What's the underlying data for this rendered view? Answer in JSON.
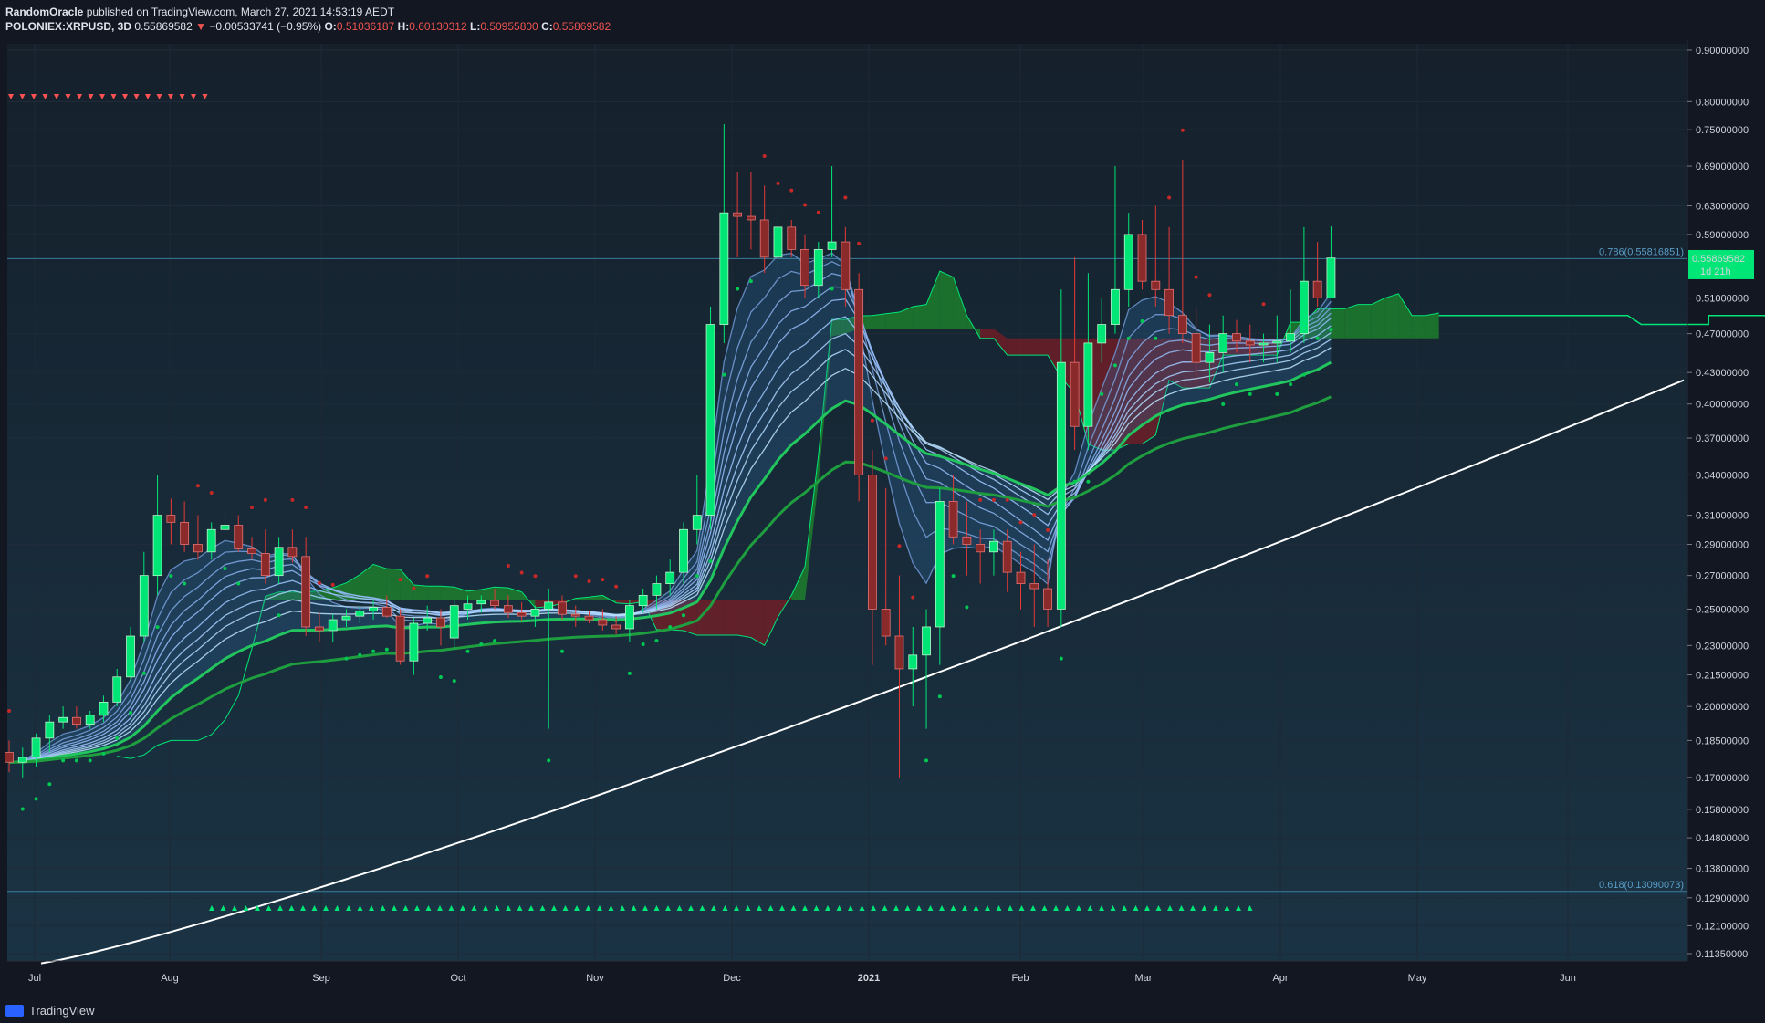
{
  "header": {
    "author": "RandomOracle",
    "published_text": " published on TradingView.com, March 27, 2021 14:53:19 AEDT",
    "symbol": "POLONIEX:XRPUSD, 3D",
    "last": "0.55869582",
    "change_arrow": "▼",
    "change": "−0.00533741 (−0.95%)",
    "o_label": "O:",
    "o": "0.51036187",
    "h_label": "H:",
    "h": "0.60130312",
    "l_label": "L:",
    "l": "0.50955800",
    "c_label": "C:",
    "c": "0.55869582"
  },
  "footer": {
    "brand": "TradingView"
  },
  "colors": {
    "background": "#131722",
    "bull": "#00e676",
    "bear": "#c0392b",
    "cloud_green": "#1f8a2c",
    "cloud_red": "#7a1e26"
  },
  "chart_data": {
    "type": "candlestick",
    "y_scale": "log",
    "ylim": [
      0.11,
      0.92
    ],
    "y_ticks": [
      "0.90000000",
      "0.80000000",
      "0.75000000",
      "0.69000000",
      "0.63000000",
      "0.59000000",
      "0.55869582",
      "0.51000000",
      "0.47000000",
      "0.43000000",
      "0.40000000",
      "0.37000000",
      "0.34000000",
      "0.31000000",
      "0.29000000",
      "0.27000000",
      "0.25000000",
      "0.23000000",
      "0.21500000",
      "0.20000000",
      "0.18500000",
      "0.17000000",
      "0.15800000",
      "0.14800000",
      "0.13800000",
      "0.12900000",
      "0.12100000",
      "0.11350000"
    ],
    "x_labels": [
      "Jul",
      "Aug",
      "Sep",
      "Oct",
      "Nov",
      "Dec",
      "2021",
      "Feb",
      "Mar",
      "Apr",
      "May",
      "Jun"
    ],
    "price_label": "0.55869582",
    "countdown": "1d 21h",
    "fib_lines": [
      {
        "label": "0.786(0.55816851)",
        "value": 0.55816851
      },
      {
        "label": "0.618(0.13090073)",
        "value": 0.13090073
      }
    ],
    "candles": [
      {
        "o": 0.18,
        "h": 0.185,
        "l": 0.172,
        "c": 0.176
      },
      {
        "o": 0.176,
        "h": 0.182,
        "l": 0.17,
        "c": 0.178
      },
      {
        "o": 0.178,
        "h": 0.188,
        "l": 0.174,
        "c": 0.186
      },
      {
        "o": 0.186,
        "h": 0.196,
        "l": 0.18,
        "c": 0.193
      },
      {
        "o": 0.193,
        "h": 0.2,
        "l": 0.19,
        "c": 0.195
      },
      {
        "o": 0.195,
        "h": 0.2,
        "l": 0.19,
        "c": 0.192
      },
      {
        "o": 0.192,
        "h": 0.198,
        "l": 0.19,
        "c": 0.196
      },
      {
        "o": 0.196,
        "h": 0.205,
        "l": 0.193,
        "c": 0.202
      },
      {
        "o": 0.202,
        "h": 0.218,
        "l": 0.2,
        "c": 0.214
      },
      {
        "o": 0.214,
        "h": 0.24,
        "l": 0.212,
        "c": 0.235
      },
      {
        "o": 0.235,
        "h": 0.285,
        "l": 0.232,
        "c": 0.27
      },
      {
        "o": 0.27,
        "h": 0.34,
        "l": 0.258,
        "c": 0.31
      },
      {
        "o": 0.31,
        "h": 0.322,
        "l": 0.29,
        "c": 0.305
      },
      {
        "o": 0.305,
        "h": 0.32,
        "l": 0.285,
        "c": 0.29
      },
      {
        "o": 0.29,
        "h": 0.31,
        "l": 0.28,
        "c": 0.285
      },
      {
        "o": 0.285,
        "h": 0.305,
        "l": 0.28,
        "c": 0.3
      },
      {
        "o": 0.3,
        "h": 0.312,
        "l": 0.295,
        "c": 0.303
      },
      {
        "o": 0.303,
        "h": 0.31,
        "l": 0.285,
        "c": 0.287
      },
      {
        "o": 0.287,
        "h": 0.295,
        "l": 0.28,
        "c": 0.284
      },
      {
        "o": 0.284,
        "h": 0.3,
        "l": 0.265,
        "c": 0.27
      },
      {
        "o": 0.27,
        "h": 0.295,
        "l": 0.265,
        "c": 0.288
      },
      {
        "o": 0.288,
        "h": 0.3,
        "l": 0.278,
        "c": 0.282
      },
      {
        "o": 0.282,
        "h": 0.295,
        "l": 0.235,
        "c": 0.24
      },
      {
        "o": 0.24,
        "h": 0.248,
        "l": 0.232,
        "c": 0.238
      },
      {
        "o": 0.238,
        "h": 0.247,
        "l": 0.232,
        "c": 0.244
      },
      {
        "o": 0.244,
        "h": 0.25,
        "l": 0.24,
        "c": 0.246
      },
      {
        "o": 0.246,
        "h": 0.252,
        "l": 0.242,
        "c": 0.249
      },
      {
        "o": 0.249,
        "h": 0.255,
        "l": 0.244,
        "c": 0.251
      },
      {
        "o": 0.251,
        "h": 0.258,
        "l": 0.245,
        "c": 0.246
      },
      {
        "o": 0.246,
        "h": 0.25,
        "l": 0.22,
        "c": 0.222
      },
      {
        "o": 0.222,
        "h": 0.245,
        "l": 0.215,
        "c": 0.242
      },
      {
        "o": 0.242,
        "h": 0.252,
        "l": 0.238,
        "c": 0.245
      },
      {
        "o": 0.245,
        "h": 0.25,
        "l": 0.23,
        "c": 0.24
      },
      {
        "o": 0.234,
        "h": 0.255,
        "l": 0.228,
        "c": 0.252
      },
      {
        "o": 0.25,
        "h": 0.258,
        "l": 0.244,
        "c": 0.253
      },
      {
        "o": 0.253,
        "h": 0.258,
        "l": 0.248,
        "c": 0.255
      },
      {
        "o": 0.255,
        "h": 0.262,
        "l": 0.25,
        "c": 0.252
      },
      {
        "o": 0.252,
        "h": 0.258,
        "l": 0.245,
        "c": 0.248
      },
      {
        "o": 0.248,
        "h": 0.254,
        "l": 0.243,
        "c": 0.246
      },
      {
        "o": 0.246,
        "h": 0.252,
        "l": 0.24,
        "c": 0.25
      },
      {
        "o": 0.25,
        "h": 0.262,
        "l": 0.19,
        "c": 0.254
      },
      {
        "o": 0.254,
        "h": 0.258,
        "l": 0.244,
        "c": 0.247
      },
      {
        "o": 0.247,
        "h": 0.252,
        "l": 0.24,
        "c": 0.246
      },
      {
        "o": 0.246,
        "h": 0.249,
        "l": 0.242,
        "c": 0.244
      },
      {
        "o": 0.244,
        "h": 0.25,
        "l": 0.238,
        "c": 0.241
      },
      {
        "o": 0.241,
        "h": 0.246,
        "l": 0.236,
        "c": 0.239
      },
      {
        "o": 0.239,
        "h": 0.255,
        "l": 0.232,
        "c": 0.252
      },
      {
        "o": 0.252,
        "h": 0.262,
        "l": 0.248,
        "c": 0.258
      },
      {
        "o": 0.258,
        "h": 0.27,
        "l": 0.25,
        "c": 0.265
      },
      {
        "o": 0.265,
        "h": 0.28,
        "l": 0.258,
        "c": 0.272
      },
      {
        "o": 0.272,
        "h": 0.305,
        "l": 0.265,
        "c": 0.3
      },
      {
        "o": 0.3,
        "h": 0.34,
        "l": 0.29,
        "c": 0.31
      },
      {
        "o": 0.31,
        "h": 0.5,
        "l": 0.3,
        "c": 0.48
      },
      {
        "o": 0.48,
        "h": 0.76,
        "l": 0.46,
        "c": 0.62
      },
      {
        "o": 0.62,
        "h": 0.68,
        "l": 0.56,
        "c": 0.615
      },
      {
        "o": 0.615,
        "h": 0.68,
        "l": 0.57,
        "c": 0.61
      },
      {
        "o": 0.61,
        "h": 0.66,
        "l": 0.54,
        "c": 0.56
      },
      {
        "o": 0.56,
        "h": 0.62,
        "l": 0.54,
        "c": 0.6
      },
      {
        "o": 0.6,
        "h": 0.61,
        "l": 0.56,
        "c": 0.57
      },
      {
        "o": 0.57,
        "h": 0.59,
        "l": 0.51,
        "c": 0.525
      },
      {
        "o": 0.525,
        "h": 0.58,
        "l": 0.51,
        "c": 0.57
      },
      {
        "o": 0.57,
        "h": 0.69,
        "l": 0.56,
        "c": 0.58
      },
      {
        "o": 0.58,
        "h": 0.6,
        "l": 0.5,
        "c": 0.52
      },
      {
        "o": 0.52,
        "h": 0.54,
        "l": 0.32,
        "c": 0.34
      },
      {
        "o": 0.34,
        "h": 0.36,
        "l": 0.22,
        "c": 0.25
      },
      {
        "o": 0.25,
        "h": 0.33,
        "l": 0.23,
        "c": 0.235
      },
      {
        "o": 0.235,
        "h": 0.27,
        "l": 0.17,
        "c": 0.218
      },
      {
        "o": 0.218,
        "h": 0.24,
        "l": 0.2,
        "c": 0.225
      },
      {
        "o": 0.225,
        "h": 0.25,
        "l": 0.19,
        "c": 0.24
      },
      {
        "o": 0.24,
        "h": 0.33,
        "l": 0.22,
        "c": 0.32
      },
      {
        "o": 0.32,
        "h": 0.34,
        "l": 0.29,
        "c": 0.295
      },
      {
        "o": 0.295,
        "h": 0.32,
        "l": 0.27,
        "c": 0.29
      },
      {
        "o": 0.29,
        "h": 0.3,
        "l": 0.265,
        "c": 0.285
      },
      {
        "o": 0.285,
        "h": 0.3,
        "l": 0.27,
        "c": 0.292
      },
      {
        "o": 0.292,
        "h": 0.3,
        "l": 0.26,
        "c": 0.272
      },
      {
        "o": 0.272,
        "h": 0.285,
        "l": 0.25,
        "c": 0.265
      },
      {
        "o": 0.265,
        "h": 0.29,
        "l": 0.24,
        "c": 0.262
      },
      {
        "o": 0.262,
        "h": 0.28,
        "l": 0.24,
        "c": 0.25
      },
      {
        "o": 0.25,
        "h": 0.52,
        "l": 0.24,
        "c": 0.44
      },
      {
        "o": 0.44,
        "h": 0.56,
        "l": 0.36,
        "c": 0.38
      },
      {
        "o": 0.38,
        "h": 0.54,
        "l": 0.36,
        "c": 0.46
      },
      {
        "o": 0.46,
        "h": 0.51,
        "l": 0.44,
        "c": 0.48
      },
      {
        "o": 0.48,
        "h": 0.69,
        "l": 0.47,
        "c": 0.52
      },
      {
        "o": 0.52,
        "h": 0.62,
        "l": 0.5,
        "c": 0.59
      },
      {
        "o": 0.59,
        "h": 0.61,
        "l": 0.52,
        "c": 0.53
      },
      {
        "o": 0.53,
        "h": 0.63,
        "l": 0.5,
        "c": 0.52
      },
      {
        "o": 0.52,
        "h": 0.6,
        "l": 0.47,
        "c": 0.49
      },
      {
        "o": 0.49,
        "h": 0.7,
        "l": 0.46,
        "c": 0.47
      },
      {
        "o": 0.47,
        "h": 0.5,
        "l": 0.42,
        "c": 0.44
      },
      {
        "o": 0.44,
        "h": 0.48,
        "l": 0.42,
        "c": 0.45
      },
      {
        "o": 0.45,
        "h": 0.49,
        "l": 0.43,
        "c": 0.47
      },
      {
        "o": 0.47,
        "h": 0.485,
        "l": 0.45,
        "c": 0.462
      },
      {
        "o": 0.462,
        "h": 0.48,
        "l": 0.44,
        "c": 0.458
      },
      {
        "o": 0.458,
        "h": 0.47,
        "l": 0.44,
        "c": 0.46
      },
      {
        "o": 0.46,
        "h": 0.49,
        "l": 0.44,
        "c": 0.462
      },
      {
        "o": 0.462,
        "h": 0.52,
        "l": 0.45,
        "c": 0.47
      },
      {
        "o": 0.47,
        "h": 0.6,
        "l": 0.46,
        "c": 0.53
      },
      {
        "o": 0.53,
        "h": 0.58,
        "l": 0.5,
        "c": 0.51
      },
      {
        "o": 0.51,
        "h": 0.601,
        "l": 0.51,
        "c": 0.559
      }
    ]
  }
}
